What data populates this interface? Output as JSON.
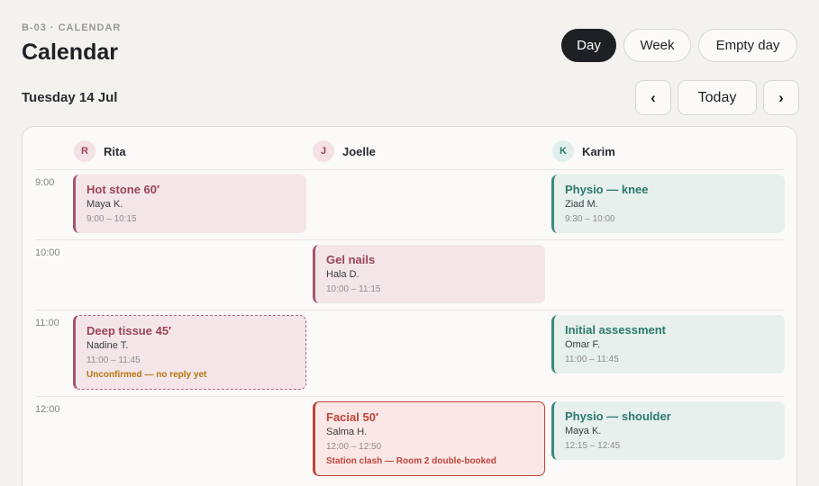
{
  "header": {
    "breadcrumb": "B-03 · CALENDAR",
    "title": "Calendar"
  },
  "views": [
    {
      "label": "Day",
      "active": true
    },
    {
      "label": "Week",
      "active": false
    },
    {
      "label": "Empty day",
      "active": false
    }
  ],
  "date_label": "Tuesday 14 Jul",
  "nav": {
    "prev_icon": "chevron-left-icon",
    "prev_glyph": "‹",
    "today_label": "Today",
    "next_icon": "chevron-right-icon",
    "next_glyph": "›"
  },
  "staff": [
    {
      "initial": "R",
      "name": "Rita"
    },
    {
      "initial": "J",
      "name": "Joelle"
    },
    {
      "initial": "K",
      "name": "Karim"
    }
  ],
  "times": [
    "9:00",
    "10:00",
    "11:00",
    "12:00"
  ],
  "appointments": {
    "rita_1": {
      "title": "Hot stone 60′",
      "client": "Maya K.",
      "time": "9:00 – 10:15"
    },
    "rita_2": {
      "title": "Deep tissue 45′",
      "client": "Nadine T.",
      "time": "11:00 – 11:45",
      "warning": "Unconfirmed — no reply yet"
    },
    "joelle_1": {
      "title": "Gel nails",
      "client": "Hala D.",
      "time": "10:00 – 11:15"
    },
    "joelle_2": {
      "title": "Facial 50′",
      "client": "Salma H.",
      "time": "12:00 – 12:50",
      "warning": "Station clash — Room 2 double-booked"
    },
    "karim_1": {
      "title": "Physio — knee",
      "client": "Ziad M.",
      "time": "9:30 – 10:00"
    },
    "karim_2": {
      "title": "Initial assessment",
      "client": "Omar F.",
      "time": "11:00 – 11:45"
    },
    "karim_3": {
      "title": "Physio — shoulder",
      "client": "Maya K.",
      "time": "12:15 – 12:45"
    }
  },
  "colors": {
    "rose_accent": "#a45668",
    "mint_accent": "#3d8a79",
    "clash_red": "#c0443b",
    "warning_amber": "#b3760f",
    "active_pill": "#1f2024"
  }
}
